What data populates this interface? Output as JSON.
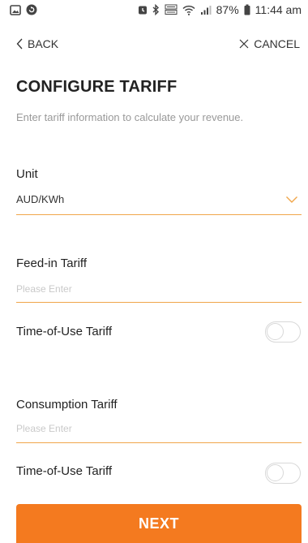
{
  "status_bar": {
    "battery": "87%",
    "time": "11:44 am",
    "icons": [
      "gallery-icon",
      "refresh-icon",
      "alarm-icon",
      "bluetooth-icon",
      "volte-icon",
      "wifi-icon",
      "signal-icon",
      "battery-icon"
    ]
  },
  "nav": {
    "back_label": "BACK",
    "cancel_label": "CANCEL"
  },
  "header": {
    "title": "CONFIGURE TARIFF",
    "subtitle": "Enter tariff information to calculate your revenue."
  },
  "form": {
    "unit": {
      "label": "Unit",
      "value": "AUD/KWh"
    },
    "feed_in": {
      "label": "Feed-in Tariff",
      "placeholder": "Please Enter",
      "tou_label": "Time-of-Use Tariff",
      "tou_enabled": false
    },
    "consumption": {
      "label": "Consumption Tariff",
      "placeholder": "Please Enter",
      "tou_label": "Time-of-Use Tariff",
      "tou_enabled": false
    }
  },
  "footer": {
    "next_label": "NEXT"
  },
  "colors": {
    "accent": "#f47a1f",
    "underline": "#f0a64a",
    "placeholder": "#c9c9c9"
  }
}
